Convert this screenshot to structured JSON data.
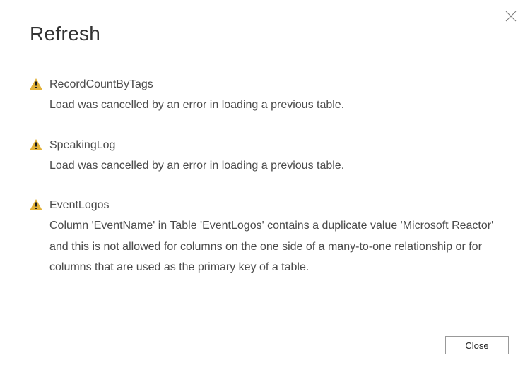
{
  "dialog": {
    "title": "Refresh",
    "close_btn_label": "Close"
  },
  "items": [
    {
      "name": "RecordCountByTags",
      "message": "Load was cancelled by an error in loading a previous table."
    },
    {
      "name": "SpeakingLog",
      "message": "Load was cancelled by an error in loading a previous table."
    },
    {
      "name": "EventLogos",
      "message": "Column 'EventName' in Table 'EventLogos' contains a duplicate value 'Microsoft Reactor' and this is not allowed for columns on the one side of a many-to-one relationship or for columns that are used as the primary key of a table."
    }
  ]
}
